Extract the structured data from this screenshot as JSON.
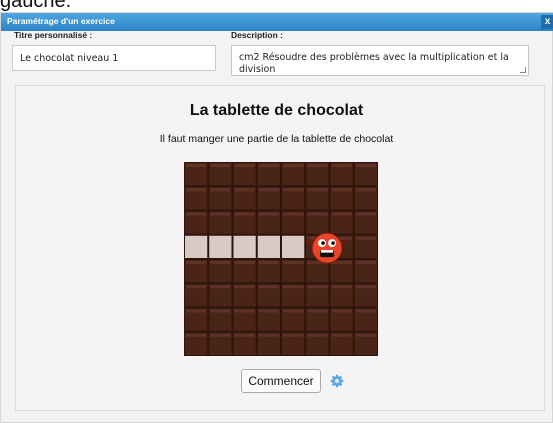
{
  "page_fragment": "gauche.",
  "dialog": {
    "title": "Paramétrage d'un exercice",
    "close_glyph": "x",
    "title_label": "Titre personnalisé :",
    "title_value": "Le chocolat niveau 1",
    "desc_label": "Description :",
    "desc_value": "cm2 Résoudre des problèmes avec la multiplication et la division"
  },
  "game": {
    "title": "La tablette de chocolat",
    "subtitle": "Il faut manger une partie de la tablette de chocolat",
    "grid": {
      "columns": 8,
      "rows": 8,
      "eaten_row": 3,
      "eaten_columns": 5,
      "monster_column": 5
    },
    "colors": {
      "chocolate": "#4a2417",
      "eaten": "#d9cac6",
      "monster": "#e8452a",
      "accent": "#2b83c5"
    }
  },
  "actions": {
    "start_label": "Commencer",
    "settings_icon": "gear-icon"
  }
}
